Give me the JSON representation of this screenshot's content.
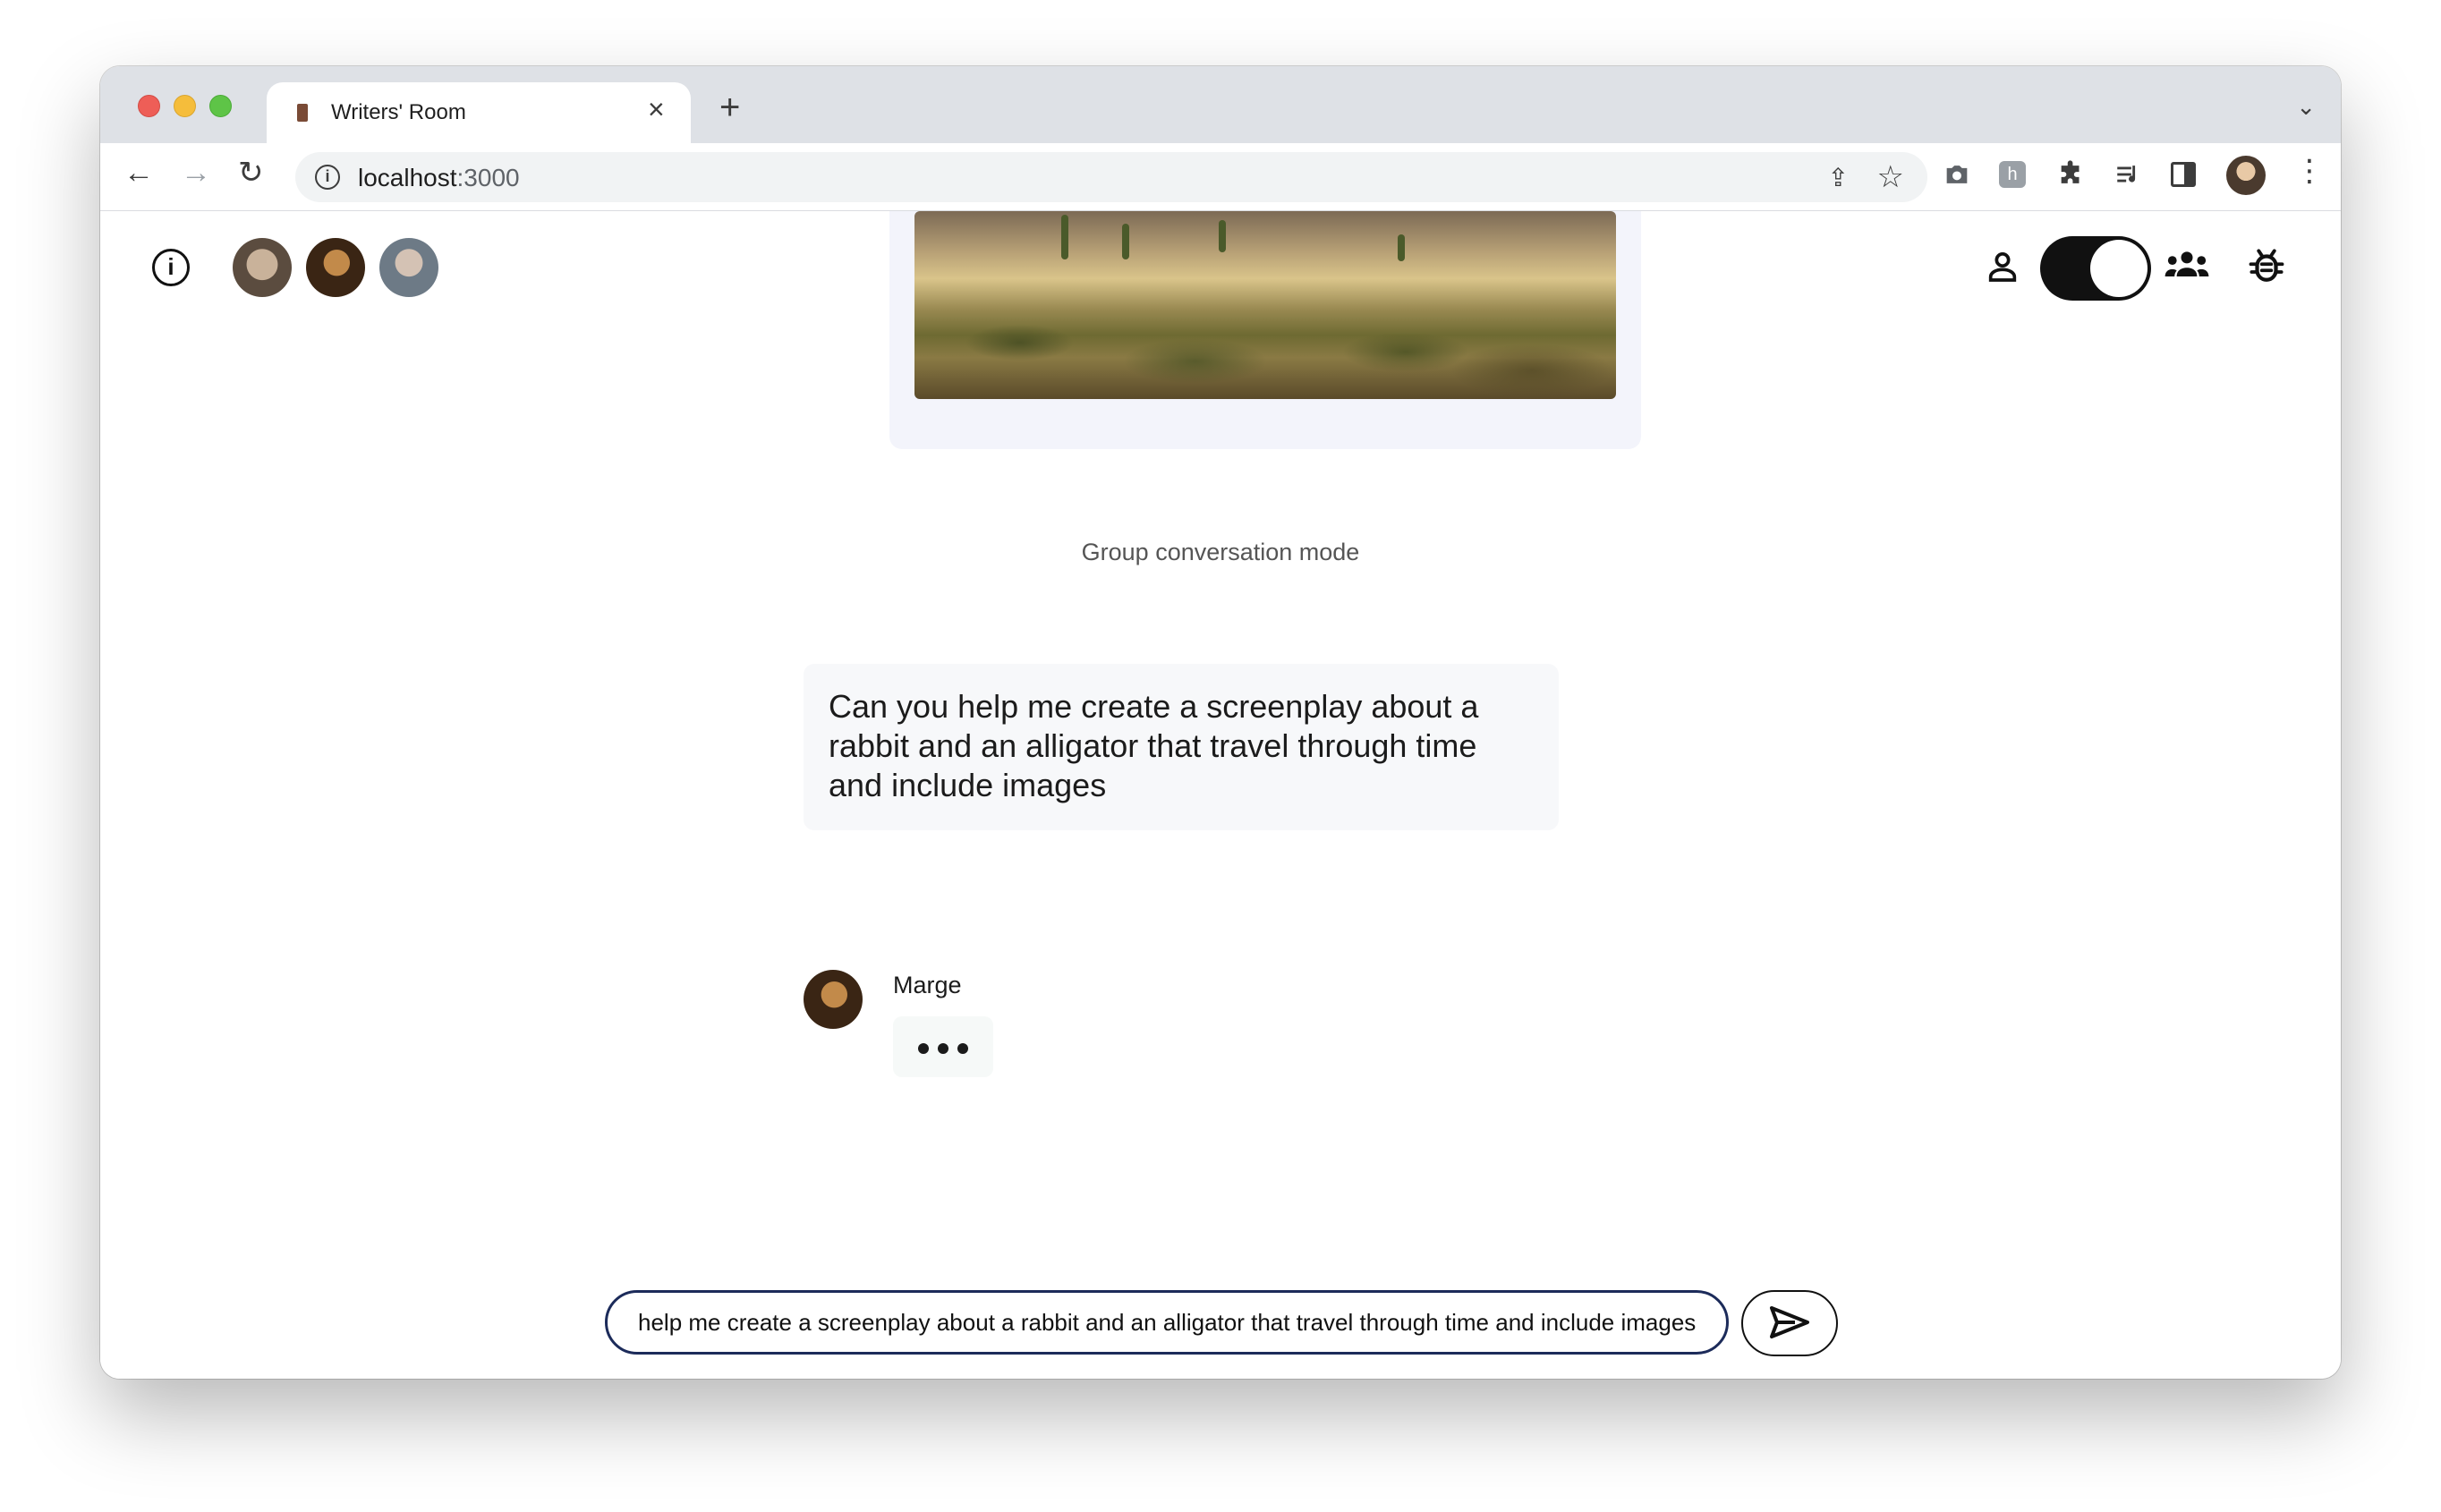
{
  "browser": {
    "tab_title": "Writers' Room",
    "tab_close": "×",
    "new_tab": "+",
    "tab_list": "⌄",
    "back": "←",
    "forward": "→",
    "reload": "↻",
    "url_host": "localhost",
    "url_port": ":3000",
    "share": "⇪",
    "star": "☆",
    "camera": "📷",
    "puzzle": "✚",
    "media": "≡",
    "menu": "⋮"
  },
  "header": {
    "info": "i",
    "characters": [
      "character-1",
      "Marge",
      "character-3"
    ],
    "mode": "group"
  },
  "conversation": {
    "mode_label": "Group conversation mode",
    "user_message": "Can you help me create a screenplay about a rabbit and an alligator that travel through time and include images",
    "reply_author": "Marge",
    "reply_state": "typing"
  },
  "composer": {
    "value": "help me create a screenplay about a rabbit and an alligator that travel through time and include images"
  },
  "icons": {
    "info": "info-icon",
    "single": "person-icon",
    "group": "group-icon",
    "debug": "bug-icon",
    "send": "send-icon"
  }
}
